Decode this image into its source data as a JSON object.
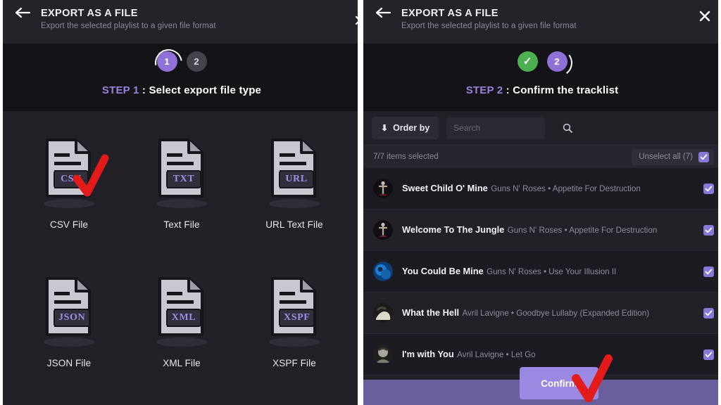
{
  "left_panel": {
    "header": {
      "back_icon": "back-arrow-icon",
      "title": "EXPORT AS A FILE",
      "subtitle": "Export the selected playlist to a given file format",
      "close_icon": "close-icon"
    },
    "stepper": {
      "steps": [
        {
          "label": "1",
          "state": "active"
        },
        {
          "label": "2",
          "state": "inactive"
        }
      ]
    },
    "step_title": {
      "lead": "STEP 1",
      "rest": " : Select export file type"
    },
    "file_types": [
      {
        "ext": "CSV",
        "label": "CSV File",
        "icon": "csv-file-icon",
        "annotated": true
      },
      {
        "ext": "TXT",
        "label": "Text File",
        "icon": "txt-file-icon",
        "annotated": false
      },
      {
        "ext": "URL",
        "label": "URL Text File",
        "icon": "url-file-icon",
        "annotated": false
      },
      {
        "ext": "JSON",
        "label": "JSON File",
        "icon": "json-file-icon",
        "annotated": false
      },
      {
        "ext": "XML",
        "label": "XML File",
        "icon": "xml-file-icon",
        "annotated": false
      },
      {
        "ext": "XSPF",
        "label": "XSPF File",
        "icon": "xspf-file-icon",
        "annotated": false
      }
    ]
  },
  "right_panel": {
    "header": {
      "back_icon": "back-arrow-icon",
      "title": "EXPORT AS A FILE",
      "subtitle": "Export the selected playlist to a given file format",
      "close_icon": "close-icon"
    },
    "stepper": {
      "steps": [
        {
          "label": "✓",
          "state": "done"
        },
        {
          "label": "2",
          "state": "active"
        }
      ]
    },
    "step_title": {
      "lead": "STEP 2",
      "rest": " : Confirm the tracklist"
    },
    "toolbar": {
      "order_by_label": "Order by",
      "order_by_icon": "arrow-down-icon",
      "search_placeholder": "Search",
      "search_value": "",
      "search_icon": "search-icon"
    },
    "selection_bar": {
      "count_text": "7/7 items selected",
      "unselect_label": "Unselect all (7)",
      "unselect_checked": true
    },
    "tracks": [
      {
        "title": "Sweet Child O' Mine",
        "artist": "Guns N' Roses",
        "album": "Appetite For Destruction",
        "checked": true,
        "art": "gnr-cross"
      },
      {
        "title": "Welcome To The Jungle",
        "artist": "Guns N' Roses",
        "album": "Appetite For Destruction",
        "checked": true,
        "art": "gnr-cross"
      },
      {
        "title": "You Could Be Mine",
        "artist": "Guns N' Roses",
        "album": "Use Your Illusion II",
        "checked": true,
        "art": "blue-globe"
      },
      {
        "title": "What the Hell",
        "artist": "Avril Lavigne",
        "album": "Goodbye Lullaby (Expanded Edition)",
        "checked": true,
        "art": "avril-light"
      },
      {
        "title": "I'm with You",
        "artist": "Avril Lavigne",
        "album": "Let Go",
        "checked": true,
        "art": "avril-gray"
      }
    ],
    "separator": "•",
    "confirm_label": "Confirm"
  },
  "colors": {
    "accent_purple": "#8f71d8",
    "done_green": "#4cb050",
    "annotation_red": "#e31b1b",
    "panel_bg": "#232027",
    "band_bg": "#141318",
    "bottom_bar": "#6a5f9c",
    "confirm_bg": "#9b88e2"
  }
}
